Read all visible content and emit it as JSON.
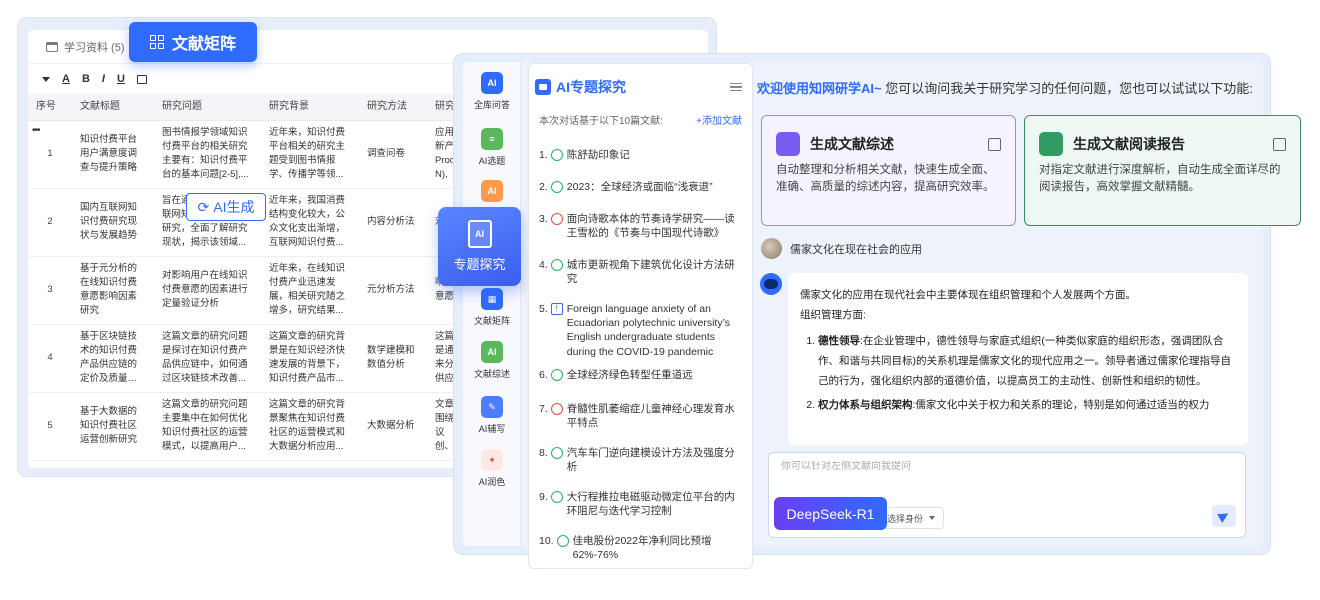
{
  "matrix": {
    "badge_label": "文献矩阵",
    "tab_label": "学习资料 (5)",
    "toolbar": [
      "A",
      "B",
      "I",
      "U"
    ],
    "columns": [
      "序号",
      "文献标题",
      "研究问题",
      "研究背景",
      "研究方法",
      "研究"
    ],
    "rows": [
      {
        "n": "1",
        "title": "知识付费平台用户满意度调查与提升策略",
        "problem": "图书情报学领域知识付费平台的相关研究主要有：知识付费平台的基本问题[2-5],...",
        "background": "近年来，知识付费平台相关的研究主题受到图书情报学、传播学等领...",
        "method": "调查问卷",
        "extra": "应用新产Prod N),"
      },
      {
        "n": "2",
        "title": "国内互联网知识付费研究现状与发展趋势",
        "problem": "旨在通过梳理国内互联网知识付费的相关研究，全面了解研究现状，揭示该领域...",
        "background": "近年来，我国消费结构变化较大，公众文化支出渐增，互联网知识付费...",
        "method": "内容分析法",
        "extra": "对我"
      },
      {
        "n": "3",
        "title": "基于元分析的在线知识付费意愿影响因素研究",
        "problem": "对影响用户在线知识付费意愿的因素进行定量验证分析",
        "background": "近年来，在线知识付费产业迅速发展，相关研究随之增多，研究结果...",
        "method": "元分析方法",
        "extra": "响用意愿"
      },
      {
        "n": "4",
        "title": "基于区块链技术的知识付费产品供应链的定价及质量决策研究",
        "problem": "这篇文章的研究问题是探讨在知识付费产品供应链中，如何通过区块链技术改善...",
        "background": "这篇文章的研究背景是在知识经济快速发展的背景下，知识付费产品市...",
        "method": "数学建模和数值分析",
        "extra": "这篇是通来分供应"
      },
      {
        "n": "5",
        "title": "基于大数据的知识付费社区运营创新研究",
        "problem": "这篇文章的研究问题主要集中在如何优化知识付费社区的运营模式，以提高用户...",
        "background": "这篇文章的研究背景聚焦在知识付费社区的运营模式和大数据分析应用...",
        "method": "大数据分析",
        "extra": "文章围绕议创、"
      }
    ],
    "ai_gen_label": "AI生成"
  },
  "sidebar": {
    "items": [
      {
        "label": "全库问答",
        "icon": "ai-chat-icon",
        "color": "#2f6bff"
      },
      {
        "label": "AI选题",
        "icon": "topic-select-icon",
        "color": "#4caf50"
      },
      {
        "label": "AI",
        "icon": "ai-icon",
        "color": "#ff8a3d"
      },
      {
        "label": "文献矩阵",
        "icon": "matrix-icon",
        "color": "#2f6bff"
      },
      {
        "label": "文献综述",
        "icon": "review-icon",
        "color": "#4caf50"
      },
      {
        "label": "AI辅写",
        "icon": "write-icon",
        "color": "#2f6bff"
      },
      {
        "label": "AI润色",
        "icon": "polish-icon",
        "color": "#e64a3b"
      }
    ],
    "highlight_label": "专题探究",
    "highlight_icon_text": "AI"
  },
  "list": {
    "title": "AI专题探究",
    "subtitle": "本次对话基于以下10篇文献:",
    "add_label": "+添加文献",
    "items": [
      {
        "n": "1.",
        "text": "陈舒劼印象记",
        "kind": "green"
      },
      {
        "n": "2.",
        "text": "2023：全球经济或面临“浅衰退”",
        "kind": "green"
      },
      {
        "n": "3.",
        "text": "面向诗歌本体的节奏诗学研究——读王雪松的《节奏与中国现代诗歌》",
        "kind": "red"
      },
      {
        "n": "4.",
        "text": "城市更新视角下建筑优化设计方法研究",
        "kind": "green"
      },
      {
        "n": "5.",
        "text": "Foreign language anxiety of an Ecuadorian polytechnic university’s English undergraduate students during the COVID-19 pandemic",
        "kind": "blue"
      },
      {
        "n": "6.",
        "text": "全球经济绿色转型任重道远",
        "kind": "green"
      },
      {
        "n": "7.",
        "text": "脊髓性肌萎缩症儿童神经心理发育水平特点",
        "kind": "red"
      },
      {
        "n": "8.",
        "text": "汽车车门逆向建模设计方法及强度分析",
        "kind": "green"
      },
      {
        "n": "9.",
        "text": "大行程推拉电磁驱动微定位平台的内环阻尼与迭代学习控制",
        "kind": "green"
      },
      {
        "n": "10.",
        "text": "佳电股份2022年净利同比预增62%-76%",
        "kind": "green"
      }
    ]
  },
  "chat": {
    "welcome_brand": "欢迎使用知网研学AI~",
    "welcome_rest": " 您可以询问我关于研究学习的任何问题，您也可以试试以下功能:",
    "card1": {
      "title": "生成文献综述",
      "desc": "自动整理和分析相关文献，快速生成全面、准确、高质量的综述内容，提高研究效率。",
      "color": "#7b5cf0"
    },
    "card2": {
      "title": "生成文献阅读报告",
      "desc": "对指定文献进行深度解析，自动生成全面详尽的阅读报告，高效掌握文献精髓。",
      "color": "#2e9c63"
    },
    "question": "儒家文化在现在社会的应用",
    "answer_intro": "儒家文化的应用在现代社会中主要体现在组织管理和个人发展两个方面。",
    "answer_section": "组织管理方面:",
    "answer_points": [
      {
        "term": "德性领导",
        "text": ":在企业管理中，德性领导与家庭式组织(一种类似家庭的组织形态，强调团队合作、和谐与共同目标)的关系机理是儒家文化的现代应用之一。领导者通过儒家伦理指导自己的行为，强化组织内部的道德价值，以提高员工的主动性、创新性和组织的韧性。"
      },
      {
        "term": "权力体系与组织架构",
        "text": ":儒家文化中关于权力和关系的理论，特别是如何通过适当的权力"
      }
    ],
    "input_placeholder": "你可以针对左侧文献向我提问",
    "model_label": "选择身份",
    "deepseek_label": "DeepSeek-R1"
  }
}
